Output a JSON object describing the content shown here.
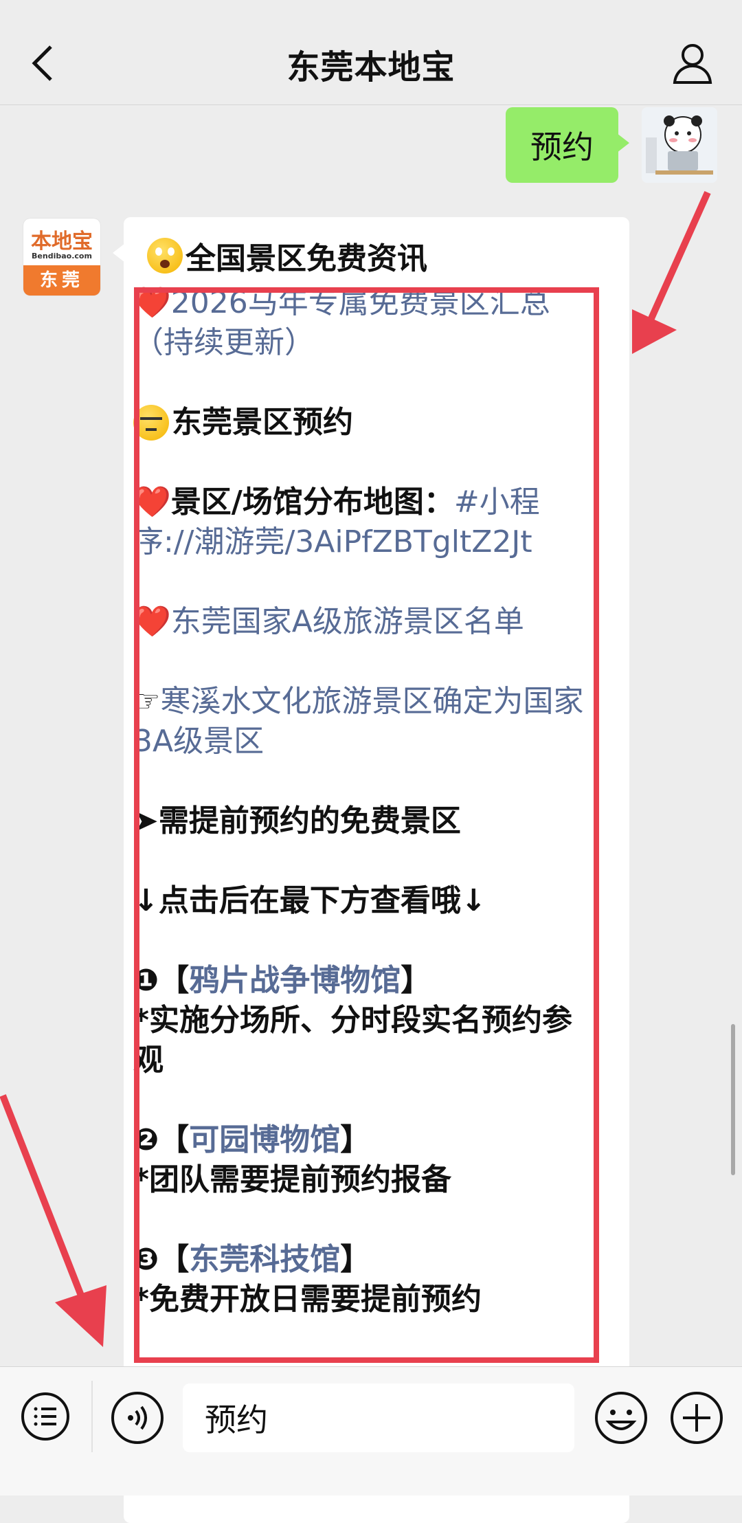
{
  "header": {
    "title": "东莞本地宝",
    "back_icon": "chevron-left-icon",
    "profile_icon": "person-icon"
  },
  "sent_message": {
    "text": "预约"
  },
  "bot_avatar": {
    "top_text": "本地宝",
    "sub_text": "Bendibao.com",
    "bottom_text": "东莞"
  },
  "received_message": {
    "heading": "全国景区免费资讯",
    "lines": [
      {
        "prefix": "❤️",
        "text": "2026马年专属免费景区汇总（持续更新）"
      },
      {
        "prefix": "",
        "text": "东莞景区预约"
      },
      {
        "prefix": "❤️",
        "label": "景区/场馆分布地图：",
        "link": "#小程序://潮游莞/3AiPfZBTgltZ2Jt"
      },
      {
        "prefix": "❤️",
        "text": "东莞国家A级旅游景区名单"
      },
      {
        "prefix": "☞",
        "text": "寒溪水文化旅游景区确定为国家3A级景区"
      },
      {
        "prefix": "➤",
        "text": "需提前预约的免费景区"
      },
      {
        "prefix": "↓",
        "text": "点击后在最下方查看哦↓"
      },
      {
        "prefix": "❶",
        "link": "鸦片战争博物馆",
        "note": "*实施分场所、分时段实名预约参观"
      },
      {
        "prefix": "❷",
        "link": "可园博物馆",
        "note": "*团队需要提前预约报备"
      },
      {
        "prefix": "❸",
        "link": "东莞科技馆",
        "note": "*免费开放日需要提前预约"
      }
    ]
  },
  "input_bar": {
    "value": "预约",
    "menu_icon": "menu-list-icon",
    "voice_icon": "voice-icon",
    "emoji_icon": "emoji-icon",
    "plus_icon": "plus-icon"
  },
  "colors": {
    "background": "#ededed",
    "sent_bubble": "#95ec69",
    "link": "#576b95",
    "annotation_red": "#e8404e",
    "brand_orange": "#f07a2e"
  }
}
